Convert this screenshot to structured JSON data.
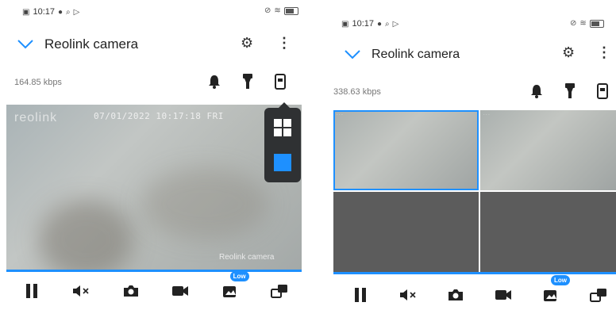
{
  "status": {
    "time": "10:17"
  },
  "app": {
    "title": "Reolink camera"
  },
  "left": {
    "bitrate": "164.85 kbps",
    "overlay": {
      "logo": "reolink",
      "timestamp": "07/01/2022 10:17:18 FRI",
      "camera_name": "Reolink camera"
    },
    "layout_popup": {
      "options": [
        "grid-4",
        "single"
      ],
      "selected": "single"
    }
  },
  "right": {
    "bitrate": "338.63 kbps",
    "grid": {
      "cells": [
        "live",
        "live",
        "empty",
        "empty"
      ],
      "selected_index": 0
    }
  },
  "controls": {
    "items": [
      "pause",
      "mute",
      "snapshot",
      "record",
      "quality",
      "multi-view"
    ],
    "quality_badge": "Low"
  },
  "colors": {
    "accent": "#1e90ff",
    "popup_bg": "#2f3133",
    "empty_cell": "#5c5c5c"
  },
  "icons": [
    "chevron-down-icon",
    "gear-icon",
    "more-vertical-icon",
    "bell-icon",
    "flashlight-icon",
    "layout-icon",
    "pause-icon",
    "speaker-mute-icon",
    "camera-icon",
    "video-icon",
    "quality-icon",
    "multiview-icon"
  ]
}
